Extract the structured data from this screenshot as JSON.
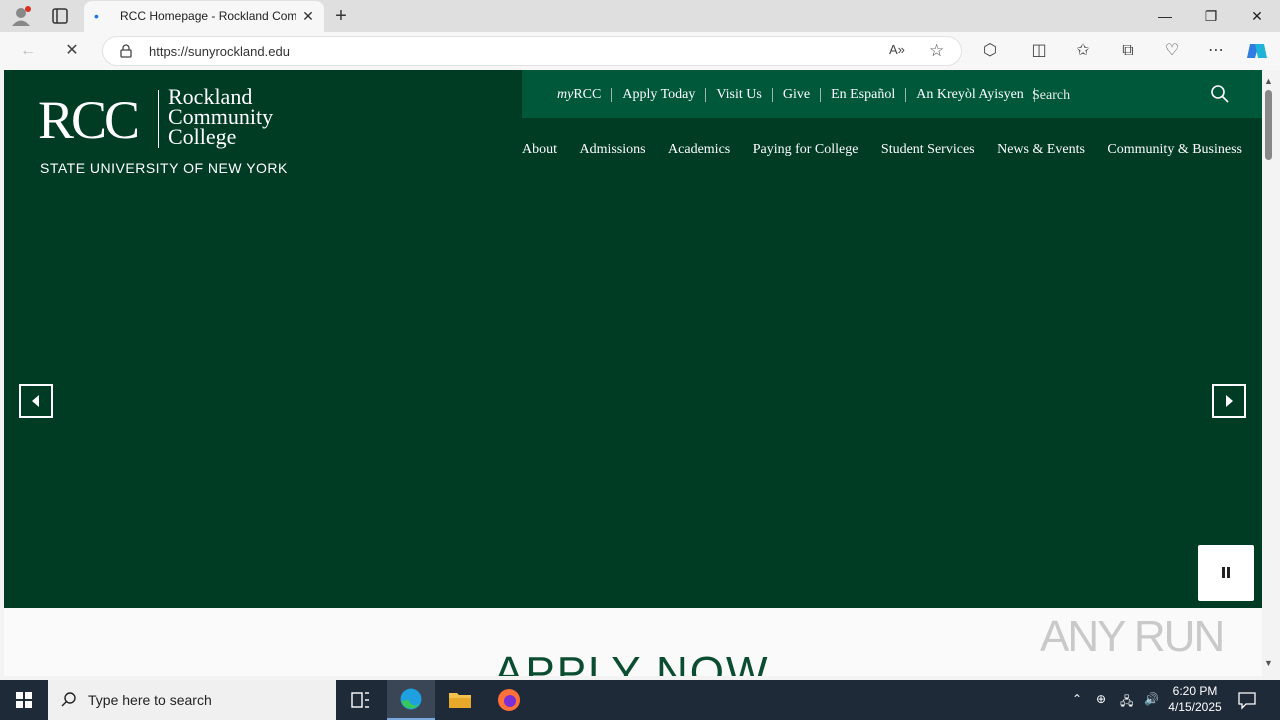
{
  "browser": {
    "tab_title": "RCC Homepage - Rockland Com",
    "url": "https://sunyrockland.edu",
    "colors": {
      "tabbar": "#dfdfdf",
      "toolbar": "#f7f7f7"
    }
  },
  "site": {
    "logo": {
      "mark": "RCC",
      "line1": "Rockland",
      "line2": "Community",
      "line3": "College",
      "tagline": "STATE UNIVERSITY OF NEW YORK"
    },
    "utility_links": [
      {
        "prefix": "my",
        "label": "RCC"
      },
      {
        "prefix": "",
        "label": "Apply Today"
      },
      {
        "prefix": "",
        "label": "Visit Us"
      },
      {
        "prefix": "",
        "label": "Give"
      },
      {
        "prefix": "",
        "label": "En Español"
      },
      {
        "prefix": "",
        "label": "An Kreyòl Ayisyen"
      }
    ],
    "search_placeholder": "Search",
    "main_nav": [
      "About",
      "Admissions",
      "Academics",
      "Paying for College",
      "Student Services",
      "News & Events",
      "Community & Business"
    ],
    "section_heading": "APPLY NOW",
    "colors": {
      "hero": "#003b24",
      "utility": "#00583a",
      "heading": "#0b4d31"
    }
  },
  "watermark": "ANY RUN",
  "taskbar": {
    "search_placeholder": "Type here to search",
    "time": "6:20 PM",
    "date": "4/15/2025"
  }
}
